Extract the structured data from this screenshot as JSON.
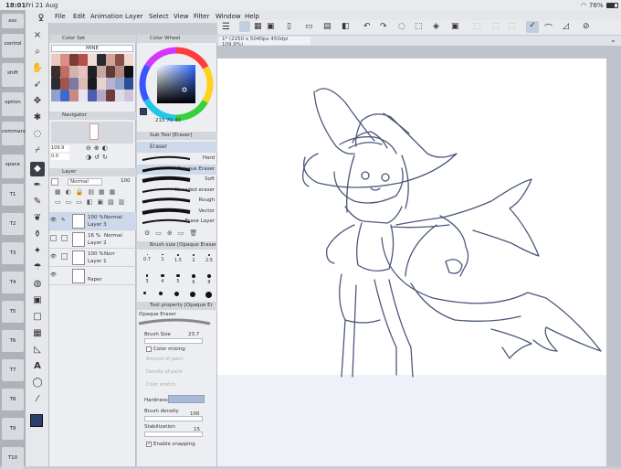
{
  "status": {
    "time": "18:01",
    "date": "Fri 21 Aug",
    "battery": "76%"
  },
  "menu": [
    "File",
    "Edit",
    "Animation",
    "Layer",
    "Select",
    "View",
    "Filter",
    "Window",
    "Help"
  ],
  "keys": [
    "esc",
    "control",
    "shift",
    "option",
    "command",
    "space",
    "T1",
    "T2",
    "T3",
    "T4",
    "T5",
    "T6",
    "T7",
    "T8",
    "T9",
    "T10"
  ],
  "color_set": {
    "title": "Color Set",
    "name": "MINE",
    "swatches": [
      "#e9c9c0",
      "#d98f84",
      "#7b3b36",
      "#b54f4d",
      "#f1ddd6",
      "#2a2b30",
      "#cfa598",
      "#8a4d47",
      "#f0d7d0",
      "#3b2e2e",
      "#c36c63",
      "#d3b4ad",
      "#e8c2bc",
      "#1f1f24",
      "#c8a79e",
      "#5c3b38",
      "#b7867e",
      "#101014",
      "#2d2d33",
      "#a05550",
      "#7b79a6",
      "#dcbcb4",
      "#1b1b1f",
      "#e7d2cd",
      "#b8b1cf",
      "#8fa4c8",
      "#2c4d9a",
      "#92a1c9",
      "#3e6bc9",
      "#c98a82",
      "#e9e4f1",
      "#4f5cad",
      "#b4a6c9",
      "#6c3c40",
      "#dedae7",
      "#ccc5d8"
    ]
  },
  "navigator": {
    "title": "Navigator",
    "zoom": "109.9",
    "angle": "0.0"
  },
  "layer": {
    "title": "Layer",
    "blend": "Normal",
    "opacity": "100",
    "items": [
      {
        "pct": "100 %",
        "mode": "Normal",
        "name": "Layer 3"
      },
      {
        "pct": "16 %",
        "mode": "Normal",
        "name": "Layer 2"
      },
      {
        "pct": "100 %",
        "mode": "Norr",
        "name": "Layer 1"
      },
      {
        "pct": "",
        "mode": "",
        "name": "Paper"
      }
    ]
  },
  "color_wheel": {
    "title": "Color Wheel",
    "h": "215",
    "s": "70",
    "v": "40",
    "main_color": "#2b3f6e"
  },
  "sub_tool": {
    "title": "Sub Tool [Eraser]",
    "group": "Eraser",
    "brushes": [
      "Hard",
      "Opaque Eraser",
      "Soft",
      "Kneaded eraser",
      "Rough",
      "Vector",
      "Erase Layer"
    ]
  },
  "brush_size": {
    "title": "Brush size [Opaque Eraser]",
    "sizes": [
      "0.7",
      "1",
      "1.5",
      "2",
      "2.5",
      "3",
      "4",
      "5",
      "6",
      "8"
    ]
  },
  "tool_property": {
    "title": "Tool property [Opaque Er",
    "preset": "Opaque Eraser",
    "brush_size_label": "Brush Size",
    "brush_size": "23.7",
    "color_mixing": "Color mixing",
    "amount_of_paint": "Amount of paint",
    "density_of_paint": "Density of paint",
    "color_stretch": "Color stretch",
    "hardness": "Hardness",
    "brush_density_label": "Brush density",
    "brush_density": "100",
    "stabilization_label": "Stabilization",
    "stabilization": "15",
    "enable_snapping": "Enable snapping"
  },
  "canvas": {
    "tab": "1* (2250 x 5040px 450dpi 109.9%)",
    "line_color": "#4a5878"
  }
}
